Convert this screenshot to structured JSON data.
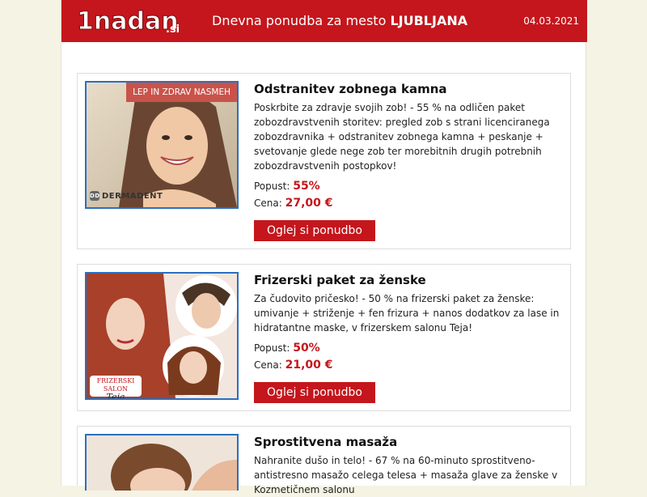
{
  "header": {
    "logo_text": "1nadan",
    "logo_suffix": ".si",
    "title_prefix": "Dnevna ponudba za mesto",
    "city": "LJUBLJANA",
    "date": "04.03.2021"
  },
  "labels": {
    "discount": "Popust:",
    "price": "Cena:",
    "cta": "Oglej si ponudbo"
  },
  "offers": [
    {
      "title": "Odstranitev zobnega kamna",
      "description": "Poskrbite za zdravje svojih zob! - 55 % na odličen paket zobozdravstvenih storitev: pregled zob s strani licenciranega zobozdravnika + odstranitev zobnega kamna + peskanje + svetovanje glede nege zob ter morebitnih drugih potrebnih zobozdravstvenih postopkov!",
      "discount": "55%",
      "price": "27,00 €",
      "image_badge": "LEP IN ZDRAV NASMEH",
      "image_brand": "DERMADENT"
    },
    {
      "title": "Frizerski paket za ženske",
      "description": "Za čudovito pričesko! - 50 % na frizerski paket za ženske: umivanje + striženje + fen frizura + nanos dodatkov za lase in hidratantne maske, v frizerskem salonu Teja!",
      "discount": "50%",
      "price": "21,00 €",
      "image_brand_top": "FRIZERSKI SALON",
      "image_brand_name": "Teja"
    },
    {
      "title": "Sprostitvena masaža",
      "description": "Nahranite dušo in telo! - 67 % na 60-minuto sprostitveno-antistresno masažo celega telesa + masaža glave za ženske v Kozmetičnem salonu"
    }
  ],
  "colors": {
    "brand_red": "#c4161c",
    "image_border": "#2b6fbf",
    "badge": "#c9534a",
    "page_bg": "#f5f3e4"
  }
}
